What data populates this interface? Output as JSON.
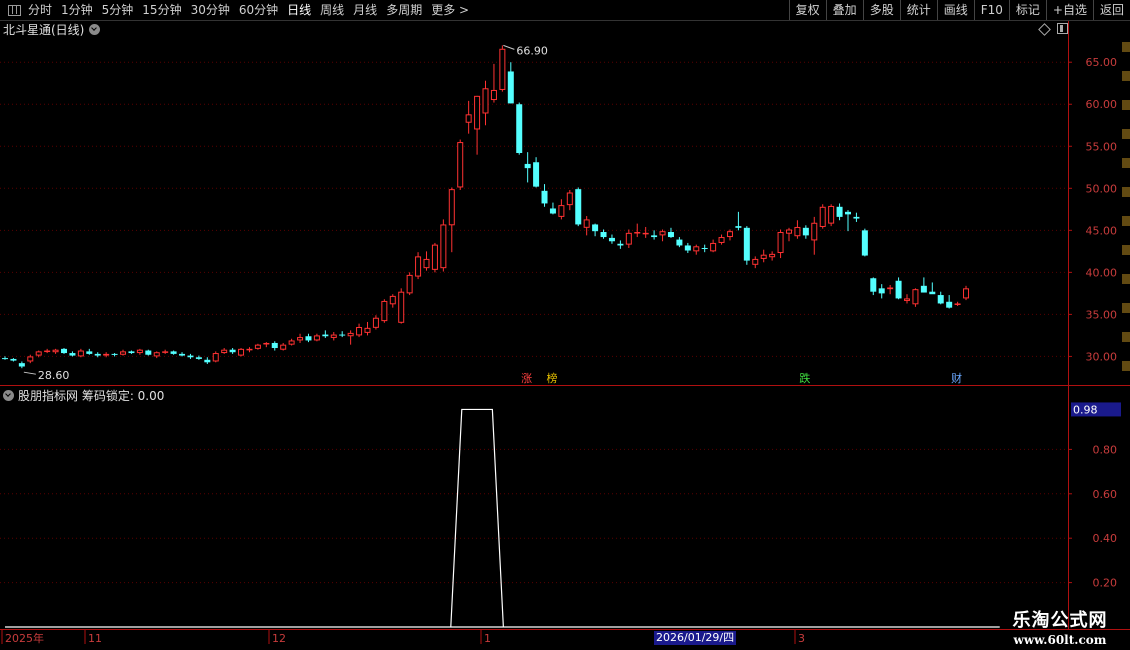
{
  "toolbar": {
    "periods": [
      "分时",
      "1分钟",
      "5分钟",
      "15分钟",
      "30分钟",
      "60分钟",
      "日线",
      "周线",
      "月线",
      "多周期",
      "更多"
    ],
    "active_index": 6,
    "more_arrow": ">",
    "right_buttons": [
      "复权",
      "叠加",
      "多股",
      "统计",
      "画线",
      "F10",
      "标记",
      "+自选",
      "返回"
    ]
  },
  "stock": {
    "title": "北斗星通(日线)"
  },
  "indicator": {
    "title": "股朋指标网 筹码锁定: 0.00",
    "current_value": "0.98"
  },
  "price_axis": {
    "labels": [
      "65.00",
      "60.00",
      "55.00",
      "50.00",
      "45.00",
      "40.00",
      "35.00",
      "30.00"
    ]
  },
  "indicator_axis": {
    "labels": [
      "0.80",
      "0.60",
      "0.40",
      "0.20"
    ]
  },
  "time_axis": {
    "labels": [
      "2025年",
      "11",
      "12",
      "1",
      "3"
    ],
    "cursor_date": "2026/01/29/四"
  },
  "annotations": {
    "high_label": "66.90",
    "low_label": "28.60",
    "markers": [
      {
        "text": "涨",
        "color": "#ff4040"
      },
      {
        "text": "榜",
        "color": "#e6c000"
      },
      {
        "text": "跌",
        "color": "#40e040"
      },
      {
        "text": "财",
        "color": "#6aa8ff"
      }
    ]
  },
  "colors": {
    "up": "#ff3232",
    "down": "#54ffff",
    "axis": "#b01010",
    "grid": "#5a0000",
    "line": "#ffffff"
  },
  "chart_data": {
    "type": "candlestick",
    "price_range": [
      26.6,
      68.0
    ],
    "indicator_range": [
      0,
      1.0
    ],
    "candles": [
      [
        29.8,
        30.0,
        29.6,
        29.7
      ],
      [
        29.7,
        29.8,
        29.4,
        29.5
      ],
      [
        29.2,
        29.4,
        28.6,
        28.8
      ],
      [
        29.4,
        30.2,
        29.2,
        30.0
      ],
      [
        30.1,
        30.7,
        29.9,
        30.6
      ],
      [
        30.6,
        30.9,
        30.4,
        30.7
      ],
      [
        30.5,
        30.9,
        30.3,
        30.8
      ],
      [
        30.9,
        31.0,
        30.3,
        30.4
      ],
      [
        30.4,
        30.6,
        30.0,
        30.1
      ],
      [
        30.0,
        30.9,
        29.9,
        30.7
      ],
      [
        30.6,
        30.9,
        30.2,
        30.3
      ],
      [
        30.3,
        30.5,
        29.9,
        30.1
      ],
      [
        30.1,
        30.5,
        29.9,
        30.3
      ],
      [
        30.3,
        30.4,
        30.0,
        30.2
      ],
      [
        30.2,
        30.8,
        30.1,
        30.6
      ],
      [
        30.6,
        30.7,
        30.3,
        30.4
      ],
      [
        30.4,
        30.9,
        30.2,
        30.8
      ],
      [
        30.7,
        30.8,
        30.1,
        30.2
      ],
      [
        30.0,
        30.6,
        29.8,
        30.5
      ],
      [
        30.5,
        30.8,
        30.3,
        30.6
      ],
      [
        30.6,
        30.7,
        30.2,
        30.3
      ],
      [
        30.3,
        30.5,
        30.0,
        30.1
      ],
      [
        30.1,
        30.3,
        29.7,
        29.9
      ],
      [
        29.9,
        30.1,
        29.6,
        29.7
      ],
      [
        29.6,
        29.9,
        29.1,
        29.3
      ],
      [
        29.4,
        30.6,
        29.3,
        30.4
      ],
      [
        30.4,
        31.0,
        30.3,
        30.8
      ],
      [
        30.8,
        31.0,
        30.3,
        30.5
      ],
      [
        30.1,
        31.0,
        30.0,
        30.9
      ],
      [
        30.9,
        31.1,
        30.5,
        30.9
      ],
      [
        30.9,
        31.5,
        30.8,
        31.4
      ],
      [
        31.5,
        31.7,
        31.1,
        31.6
      ],
      [
        31.6,
        31.8,
        30.7,
        31.0
      ],
      [
        30.8,
        31.6,
        30.7,
        31.4
      ],
      [
        31.4,
        32.1,
        31.3,
        31.9
      ],
      [
        31.9,
        32.7,
        31.6,
        32.3
      ],
      [
        32.4,
        32.7,
        31.7,
        31.9
      ],
      [
        31.9,
        32.7,
        31.8,
        32.5
      ],
      [
        32.6,
        33.1,
        32.2,
        32.4
      ],
      [
        32.2,
        32.9,
        31.9,
        32.6
      ],
      [
        32.6,
        33.0,
        32.3,
        32.5
      ],
      [
        32.4,
        33.1,
        31.4,
        32.8
      ],
      [
        32.5,
        33.9,
        32.3,
        33.5
      ],
      [
        32.8,
        34.1,
        32.5,
        33.4
      ],
      [
        33.4,
        34.9,
        33.2,
        34.6
      ],
      [
        34.2,
        36.8,
        34.0,
        36.6
      ],
      [
        36.2,
        37.4,
        35.8,
        37.2
      ],
      [
        34.0,
        38.1,
        33.9,
        37.7
      ],
      [
        37.5,
        40.0,
        37.3,
        39.7
      ],
      [
        39.5,
        42.4,
        39.2,
        41.9
      ],
      [
        40.5,
        42.5,
        40.2,
        41.6
      ],
      [
        40.3,
        43.5,
        40.0,
        43.3
      ],
      [
        40.5,
        46.3,
        40.1,
        45.7
      ],
      [
        45.6,
        50.1,
        42.4,
        49.9
      ],
      [
        50.1,
        55.8,
        49.8,
        55.5
      ],
      [
        57.8,
        60.4,
        56.5,
        58.8
      ],
      [
        57.0,
        61.0,
        54.0,
        61.0
      ],
      [
        58.9,
        62.8,
        57.5,
        61.9
      ],
      [
        60.5,
        64.8,
        60.2,
        61.7
      ],
      [
        61.7,
        67.0,
        61.5,
        66.6
      ],
      [
        63.9,
        65.0,
        60.1,
        60.1
      ],
      [
        60.0,
        60.2,
        54.0,
        54.2
      ],
      [
        52.9,
        54.3,
        50.7,
        52.4
      ],
      [
        53.1,
        53.7,
        50.1,
        50.2
      ],
      [
        49.7,
        50.5,
        47.8,
        48.2
      ],
      [
        47.6,
        48.3,
        46.9,
        47.0
      ],
      [
        46.6,
        48.7,
        46.3,
        48.0
      ],
      [
        48.0,
        49.8,
        47.4,
        49.5
      ],
      [
        49.9,
        50.1,
        45.5,
        45.7
      ],
      [
        45.3,
        46.7,
        44.4,
        46.3
      ],
      [
        45.7,
        45.8,
        44.3,
        44.9
      ],
      [
        44.8,
        45.1,
        44.0,
        44.2
      ],
      [
        44.1,
        44.5,
        43.4,
        43.7
      ],
      [
        43.4,
        43.8,
        42.8,
        43.2
      ],
      [
        43.3,
        45.1,
        42.9,
        44.7
      ],
      [
        44.7,
        45.8,
        44.2,
        44.8
      ],
      [
        44.6,
        45.4,
        44.1,
        44.7
      ],
      [
        44.4,
        45.0,
        43.9,
        44.2
      ],
      [
        44.4,
        45.1,
        43.7,
        44.9
      ],
      [
        44.8,
        45.3,
        44.1,
        44.2
      ],
      [
        43.9,
        44.2,
        43.0,
        43.2
      ],
      [
        43.2,
        43.5,
        42.3,
        42.6
      ],
      [
        42.5,
        43.3,
        42.1,
        43.1
      ],
      [
        42.9,
        43.3,
        42.4,
        42.8
      ],
      [
        42.5,
        43.9,
        42.4,
        43.5
      ],
      [
        43.5,
        44.5,
        43.3,
        44.2
      ],
      [
        44.2,
        45.1,
        43.8,
        44.9
      ],
      [
        45.5,
        47.2,
        45.0,
        45.3
      ],
      [
        45.3,
        45.5,
        40.9,
        41.4
      ],
      [
        40.9,
        41.9,
        40.5,
        41.6
      ],
      [
        41.6,
        42.7,
        41.2,
        42.1
      ],
      [
        41.8,
        42.5,
        41.4,
        42.2
      ],
      [
        42.3,
        45.1,
        41.7,
        44.8
      ],
      [
        44.6,
        45.3,
        43.7,
        45.1
      ],
      [
        44.3,
        46.2,
        44.0,
        45.4
      ],
      [
        45.3,
        45.6,
        44.0,
        44.4
      ],
      [
        43.8,
        46.6,
        42.1,
        45.9
      ],
      [
        45.4,
        48.1,
        45.2,
        47.8
      ],
      [
        45.8,
        48.1,
        45.5,
        47.9
      ],
      [
        47.8,
        48.2,
        46.2,
        46.6
      ],
      [
        47.2,
        47.4,
        44.9,
        46.9
      ],
      [
        46.6,
        47.1,
        46.0,
        46.4
      ],
      [
        45.0,
        45.2,
        41.9,
        42.0
      ],
      [
        39.3,
        39.4,
        37.3,
        37.7
      ],
      [
        38.1,
        38.6,
        36.9,
        37.5
      ],
      [
        38.0,
        38.5,
        37.4,
        38.2
      ],
      [
        39.0,
        39.4,
        36.8,
        36.9
      ],
      [
        36.6,
        37.4,
        36.3,
        36.9
      ],
      [
        36.2,
        38.1,
        35.9,
        38.0
      ],
      [
        38.4,
        39.4,
        37.6,
        37.6
      ],
      [
        37.7,
        38.8,
        37.5,
        37.4
      ],
      [
        37.3,
        37.7,
        36.2,
        36.3
      ],
      [
        36.5,
        37.3,
        35.7,
        35.8
      ],
      [
        36.2,
        36.5,
        36.0,
        36.3
      ],
      [
        36.9,
        38.4,
        36.7,
        38.1
      ]
    ],
    "indicator_values": [
      0,
      0,
      0,
      0,
      0,
      0,
      0,
      0,
      0,
      0,
      0,
      0,
      0,
      0,
      0,
      0,
      0,
      0,
      0,
      0,
      0,
      0,
      0,
      0,
      0,
      0,
      0,
      0,
      0,
      0,
      0,
      0,
      0,
      0,
      0,
      0,
      0,
      0,
      0,
      0,
      0,
      0,
      0,
      0,
      0,
      0,
      0,
      0,
      0,
      0,
      0,
      0,
      0,
      0,
      0,
      0,
      0,
      0,
      0,
      0,
      0,
      0,
      0,
      0,
      0,
      0,
      0,
      0,
      0,
      0,
      0,
      0,
      0,
      0,
      0,
      0,
      0,
      0,
      0,
      0,
      0,
      0,
      0,
      0,
      0,
      0,
      0,
      0,
      0,
      0,
      0,
      0,
      0,
      0,
      0,
      0,
      0,
      0,
      0,
      0,
      0,
      0,
      0,
      0,
      0,
      0,
      0,
      0,
      0,
      0,
      0,
      0,
      0,
      0,
      0,
      0,
      0,
      0,
      0
    ],
    "indicator_peak": {
      "start_index": 53,
      "end_index": 59,
      "value": 0.98
    }
  },
  "watermark": {
    "name": "乐淘公式网",
    "url": "www.60lt.com"
  }
}
